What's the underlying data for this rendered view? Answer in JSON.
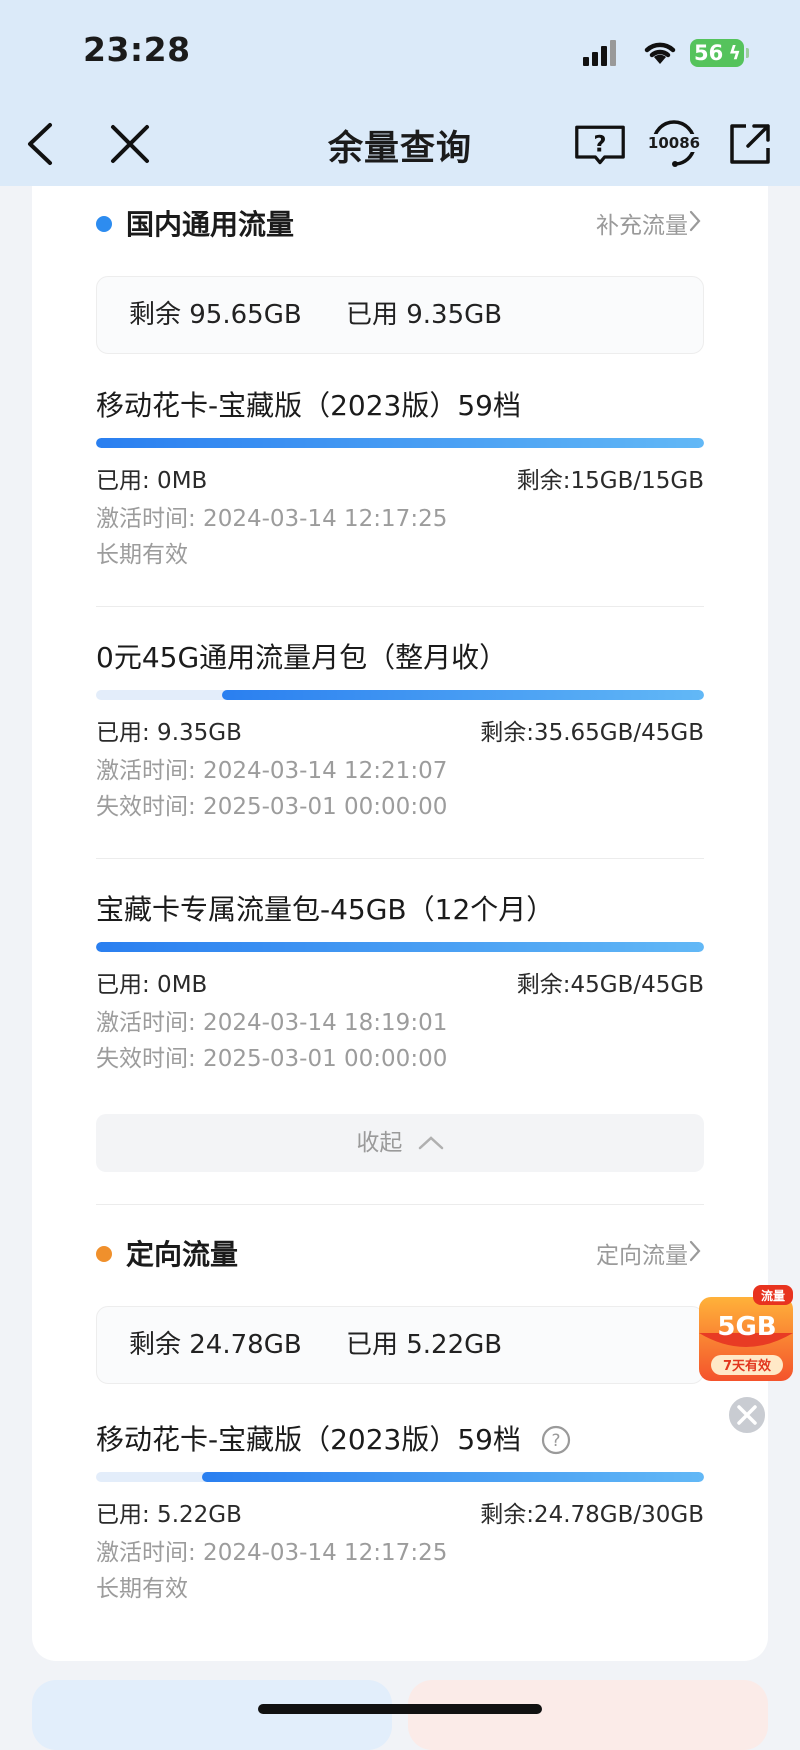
{
  "status_bar": {
    "time": "23:28",
    "battery": "56"
  },
  "nav": {
    "title": "余量查询",
    "service_label": "10086"
  },
  "general": {
    "title": "国内通用流量",
    "link": "补充流量",
    "accent": "#2d8cf0",
    "summary": {
      "remaining": "剩余 95.65GB",
      "used": "已用 9.35GB"
    },
    "packages": [
      {
        "name": "移动花卡-宝藏版（2023版）59档",
        "used": "已用: 0MB",
        "remaining": "剩余:15GB/15GB",
        "remaining_fraction": 1.0,
        "meta1": "激活时间: 2024-03-14 12:17:25",
        "meta2": "长期有效"
      },
      {
        "name": "0元45G通用流量月包（整月收）",
        "used": "已用: 9.35GB",
        "remaining": "剩余:35.65GB/45GB",
        "remaining_fraction": 0.792,
        "meta1": "激活时间: 2024-03-14 12:21:07",
        "meta2": "失效时间: 2025-03-01 00:00:00"
      },
      {
        "name": "宝藏卡专属流量包-45GB（12个月）",
        "used": "已用: 0MB",
        "remaining": "剩余:45GB/45GB",
        "remaining_fraction": 1.0,
        "meta1": "激活时间: 2024-03-14 18:19:01",
        "meta2": "失效时间: 2025-03-01 00:00:00"
      }
    ],
    "collapse_label": "收起"
  },
  "directed": {
    "title": "定向流量",
    "link": "定向流量",
    "accent": "#f0902c",
    "summary": {
      "remaining": "剩余 24.78GB",
      "used": "已用 5.22GB"
    },
    "packages": [
      {
        "name": "移动花卡-宝藏版（2023版）59档",
        "used": "已用: 5.22GB",
        "remaining": "剩余:24.78GB/30GB",
        "remaining_fraction": 0.826,
        "meta1": "激活时间: 2024-03-14 12:17:25",
        "meta2": "长期有效"
      }
    ]
  },
  "promo": {
    "tag": "流量",
    "amount": "5GB",
    "validity": "7天有效"
  }
}
